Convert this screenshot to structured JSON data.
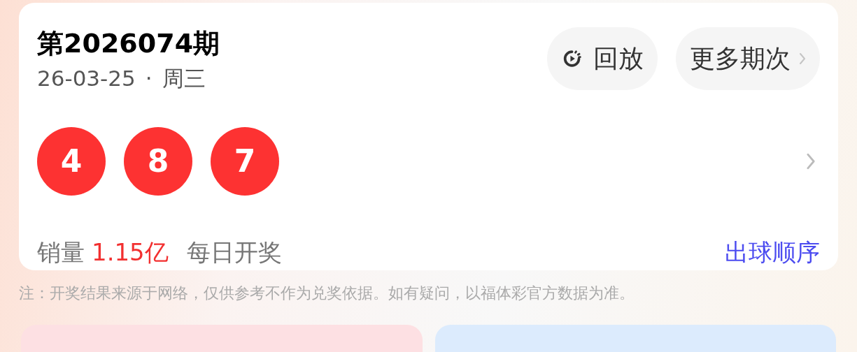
{
  "draw": {
    "title": "第2026074期",
    "date": "26-03-25",
    "separator": "·",
    "weekday": "周三"
  },
  "buttons": [
    {
      "kind": "replay",
      "label": "回放"
    },
    {
      "kind": "more",
      "label": "更多期次"
    }
  ],
  "balls": [
    {
      "number": "4",
      "color": "#fd3232"
    },
    {
      "number": "8",
      "color": "#fd3232"
    },
    {
      "number": "7",
      "color": "#fd3232"
    }
  ],
  "sales": {
    "label": "销量",
    "value": "1.15亿",
    "schedule": "每日开奖"
  },
  "order_link": "出球顺序",
  "note": "注：开奖结果来源于网络，仅供参考不作为兑奖依据。如有疑问，以福体彩官方数据为准。"
}
